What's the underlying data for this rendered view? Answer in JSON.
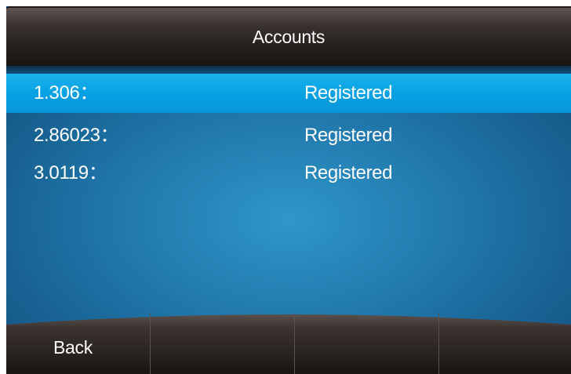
{
  "title_bar": {
    "title": "Accounts"
  },
  "accounts": [
    {
      "label": "1.306：",
      "status": "Registered",
      "selected": true
    },
    {
      "label": "2.86023：",
      "status": "Registered",
      "selected": false
    },
    {
      "label": "3.0119：",
      "status": "Registered",
      "selected": false
    }
  ],
  "softkeys": [
    {
      "label": "Back"
    },
    {
      "label": ""
    },
    {
      "label": ""
    },
    {
      "label": ""
    }
  ],
  "colors": {
    "selection_highlight": "#07a2e4",
    "background_blue": "#1f74a8",
    "bar_dark": "#231d1b",
    "text": "#ffffff"
  }
}
